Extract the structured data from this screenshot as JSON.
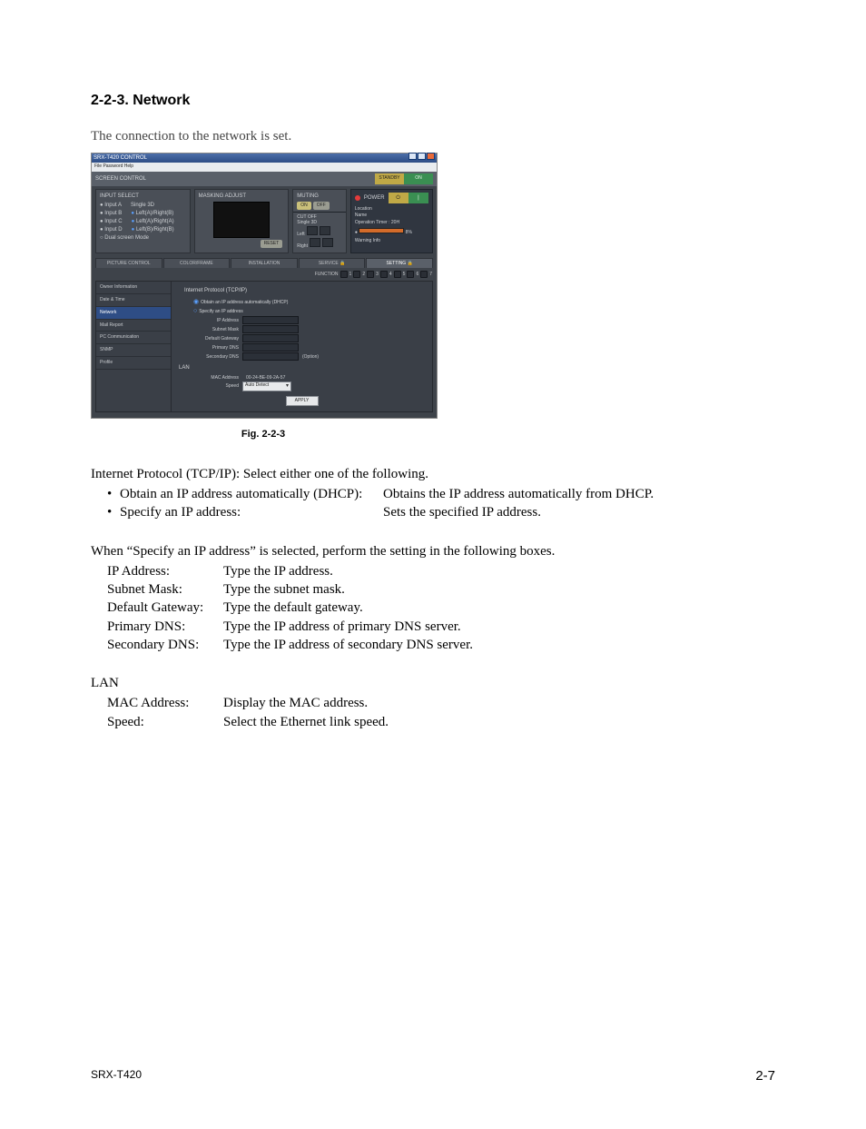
{
  "heading": "2-2-3.  Network",
  "lead": "The connection to the network is set.",
  "shot": {
    "title": "SRX-T420 CONTROL",
    "menubar": "File   Password   Help",
    "screenControl": "SCREEN CONTROL",
    "inputSelect": {
      "title": "INPUT SELECT",
      "right0": "Single 3D",
      "rows": [
        "Input A",
        "Input B",
        "Input C",
        "Input D",
        "Dual screen Mode"
      ],
      "rights": [
        "Left(A)/Right(B)",
        "Left(A)/Right(A)",
        "Left(B)/Right(B)"
      ]
    },
    "masking": {
      "title": "MASKING ADJUST",
      "reset": "RESET"
    },
    "muting": {
      "title": "MUTING",
      "on": "ON",
      "off": "OFF",
      "cutoff": "CUT OFF",
      "sub": "Single 3D",
      "left": "Left",
      "right": "Right"
    },
    "status": {
      "standby": "STANDBY",
      "on": "ON",
      "power": "POWER",
      "loc": "Location",
      "locv": "Name",
      "op": "Operation Timer",
      "opv": "20H",
      "pct": "8%",
      "warn": "Warning Info"
    },
    "tabs": [
      "PICTURE CONTROL",
      "COLOR/FRAME",
      "INSTALLATION",
      "SERVICE",
      "SETTING"
    ],
    "function": "FUNCTION",
    "sidemenu": [
      "Owner Information",
      "Date & Time",
      "Network",
      "Mail Report",
      "PC Communication",
      "SNMP",
      "Profile"
    ],
    "ip": {
      "group": "Internet Protocol (TCP/IP)",
      "r1": "Obtain an IP address automatically (DHCP)",
      "r2": "Specify an IP address",
      "ipaddr": "IP Address",
      "mask": "Subnet Mask",
      "gw": "Default Gateway",
      "pdns": "Primary DNS",
      "sdns": "Secondary DNS",
      "sdnsNote": "(Option)"
    },
    "lan": {
      "group": "LAN",
      "mac": "MAC Address",
      "macv": "00-24-BE-09-2A-57",
      "speed": "Speed",
      "speedv": "Auto Detect"
    },
    "apply": "APPLY"
  },
  "figcap": "Fig. 2-2-3",
  "body": {
    "p1": "Internet Protocol (TCP/IP): Select either one of the following.",
    "b1l": "Obtain an IP address automatically (DHCP):",
    "b1r": "Obtains the IP address automatically from DHCP.",
    "b2l": "Specify an IP address:",
    "b2r": "Sets the specified IP address.",
    "p2": "When “Specify an IP address” is selected, perform the setting in the following boxes.",
    "rows": [
      {
        "l": "IP Address:",
        "r": "Type the IP address."
      },
      {
        "l": "Subnet Mask:",
        "r": "Type the subnet mask."
      },
      {
        "l": "Default Gateway:",
        "r": "Type the default gateway."
      },
      {
        "l": "Primary DNS:",
        "r": "Type the IP address of primary DNS server."
      },
      {
        "l": "Secondary DNS:",
        "r": "Type the IP address of secondary DNS server."
      }
    ],
    "lanhdr": "LAN",
    "lanrows": [
      {
        "l": "MAC Address:",
        "r": "Display the MAC address."
      },
      {
        "l": "Speed:",
        "r": "Select the Ethernet link speed."
      }
    ]
  },
  "footer": {
    "model": "SRX-T420",
    "page": "2-7"
  }
}
